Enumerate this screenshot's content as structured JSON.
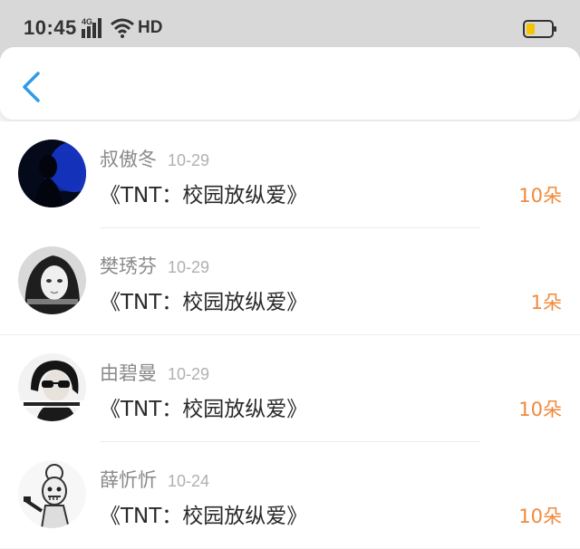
{
  "status_bar": {
    "time": "10:45",
    "network": "4G",
    "hd": "HD",
    "battery_level": 0.35,
    "battery_color": "#f5c400"
  },
  "nav": {
    "back_icon": "chevron-left-icon",
    "accent_color": "#2d9be6"
  },
  "records": [
    {
      "name": "叔傲冬",
      "date": "10-29",
      "title": "《TNT：校园放纵爱》",
      "amount": "10朵"
    },
    {
      "name": "樊琇芬",
      "date": "10-29",
      "title": "《TNT：校园放纵爱》",
      "amount": "1朵"
    },
    {
      "name": "由碧曼",
      "date": "10-29",
      "title": "《TNT：校园放纵爱》",
      "amount": "10朵"
    },
    {
      "name": "薛忻忻",
      "date": "10-24",
      "title": "《TNT：校园放纵爱》",
      "amount": "10朵"
    }
  ],
  "colors": {
    "amount": "#f08a3c",
    "name": "#8a8a8a",
    "date": "#b0b0b0"
  }
}
